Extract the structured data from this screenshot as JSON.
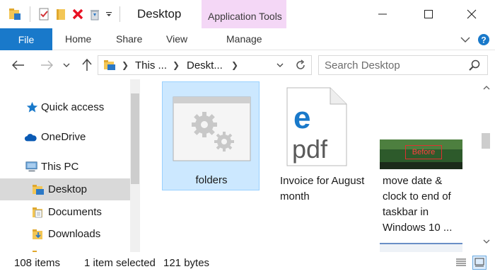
{
  "window": {
    "title": "Desktop",
    "context_tab": "Application Tools",
    "controls": [
      "minimize",
      "maximize",
      "close"
    ]
  },
  "quick_access_toolbar": {
    "icons": [
      "app-folder-icon",
      "properties-icon",
      "new-folder-icon",
      "delete-icon",
      "recycle-bin-icon",
      "customize-dropdown-icon"
    ]
  },
  "ribbon": {
    "file": "File",
    "tabs": [
      "Home",
      "Share",
      "View",
      "Manage"
    ]
  },
  "navigation": {
    "breadcrumb": [
      "This ...",
      "Deskt..."
    ],
    "search_placeholder": "Search Desktop"
  },
  "nav_pane": {
    "items": [
      {
        "label": "Quick access",
        "icon": "star-icon"
      },
      {
        "label": "OneDrive",
        "icon": "cloud-icon"
      },
      {
        "label": "This PC",
        "icon": "computer-icon"
      },
      {
        "label": "Desktop",
        "icon": "desktop-folder-icon",
        "selected": true
      },
      {
        "label": "Documents",
        "icon": "documents-icon"
      },
      {
        "label": "Downloads",
        "icon": "downloads-icon"
      }
    ]
  },
  "files": [
    {
      "name": "folders",
      "type": "application",
      "selected": true
    },
    {
      "name": "Invoice for August month",
      "type": "pdf",
      "icon_text": "pdf"
    },
    {
      "name": "move date & clock to end of taskbar in Windows 10 ...",
      "type": "image",
      "thumb_text": "Before"
    }
  ],
  "status_bar": {
    "item_count": "108 items",
    "selection": "1 item selected",
    "size": "121 bytes"
  },
  "colors": {
    "accent": "#1979ca",
    "context_tab": "#f4d7f6",
    "selection": "#cce8ff",
    "nav_selected": "#d9d9d9"
  }
}
